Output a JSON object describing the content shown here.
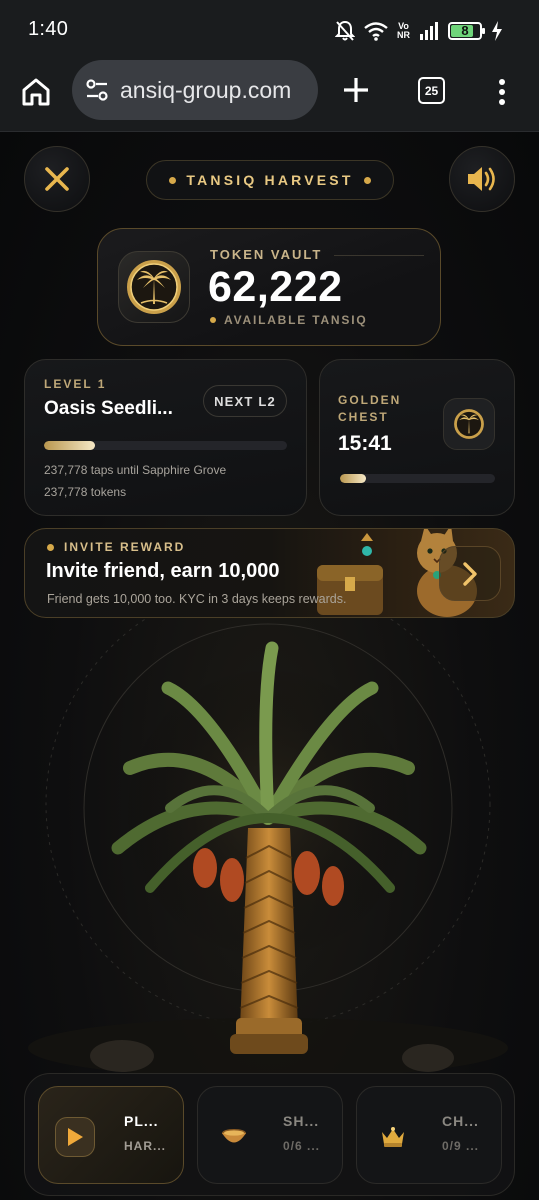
{
  "status_bar": {
    "time": "1:40",
    "volte_top": "Vo",
    "volte_bottom": "NR",
    "battery_level": 0.8,
    "battery_text": "8"
  },
  "browser": {
    "url": "ansiq-group.com",
    "tab_count": "25"
  },
  "game": {
    "title": "TANSIQ HARVEST",
    "vault": {
      "label": "TOKEN VAULT",
      "value": "62,222",
      "sub": "AVAILABLE TANSIQ"
    },
    "level": {
      "label": "LEVEL 1",
      "name": "Oasis Seedli...",
      "next": "NEXT L2",
      "progress": 0.21,
      "taps_text": "237,778 taps until Sapphire Grove",
      "tokens_text": "237,778 tokens"
    },
    "chest": {
      "label": "GOLDEN CHEST",
      "time": "15:41",
      "progress": 0.17
    },
    "invite": {
      "label": "INVITE REWARD",
      "title": "Invite friend, earn 10,000",
      "sub": "Friend gets 10,000 too. KYC in 3 days keeps rewards."
    },
    "nav": [
      {
        "line1": "PL...",
        "line2": "HAR...",
        "icon": "play-icon",
        "active": true
      },
      {
        "line1": "SH...",
        "line2": "0/6 ...",
        "icon": "bowl-icon",
        "active": false
      },
      {
        "line1": "CH...",
        "line2": "0/9 ...",
        "icon": "crown-icon",
        "active": false
      }
    ]
  },
  "colors": {
    "gold": "#d6a94a",
    "gold_text": "#e9c983",
    "background": "#0b0c0e"
  }
}
